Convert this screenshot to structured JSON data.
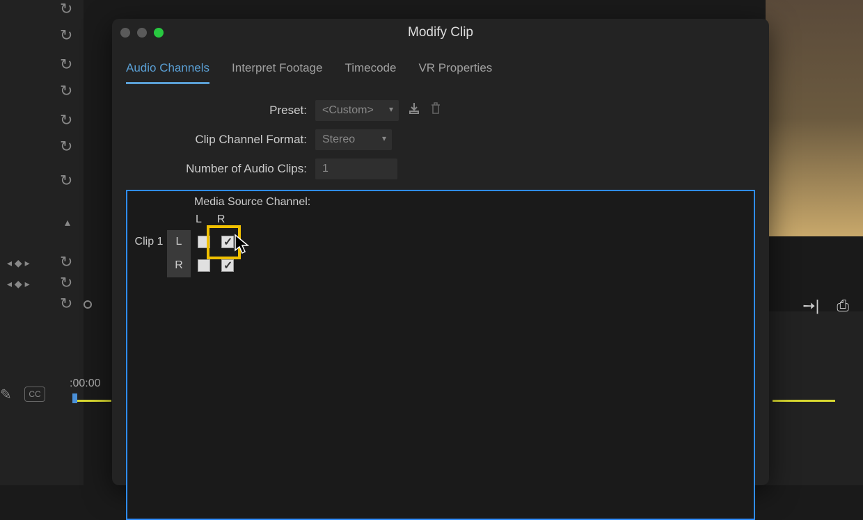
{
  "dialog": {
    "title": "Modify Clip",
    "tabs": [
      {
        "label": "Audio Channels",
        "active": true
      },
      {
        "label": "Interpret Footage",
        "active": false
      },
      {
        "label": "Timecode",
        "active": false
      },
      {
        "label": "VR Properties",
        "active": false
      }
    ],
    "form": {
      "preset_label": "Preset:",
      "preset_value": "<Custom>",
      "clip_format_label": "Clip Channel Format:",
      "clip_format_value": "Stereo",
      "num_clips_label": "Number of Audio Clips:",
      "num_clips_value": "1"
    },
    "channel_matrix": {
      "header": "Media Source Channel:",
      "columns": [
        "L",
        "R"
      ],
      "clip_label": "Clip 1",
      "rows": [
        {
          "label": "L",
          "checks": [
            false,
            true
          ]
        },
        {
          "label": "R",
          "checks": [
            false,
            true
          ]
        }
      ]
    }
  },
  "timeline": {
    "time_label": ":00:00",
    "cc_label": "CC"
  }
}
